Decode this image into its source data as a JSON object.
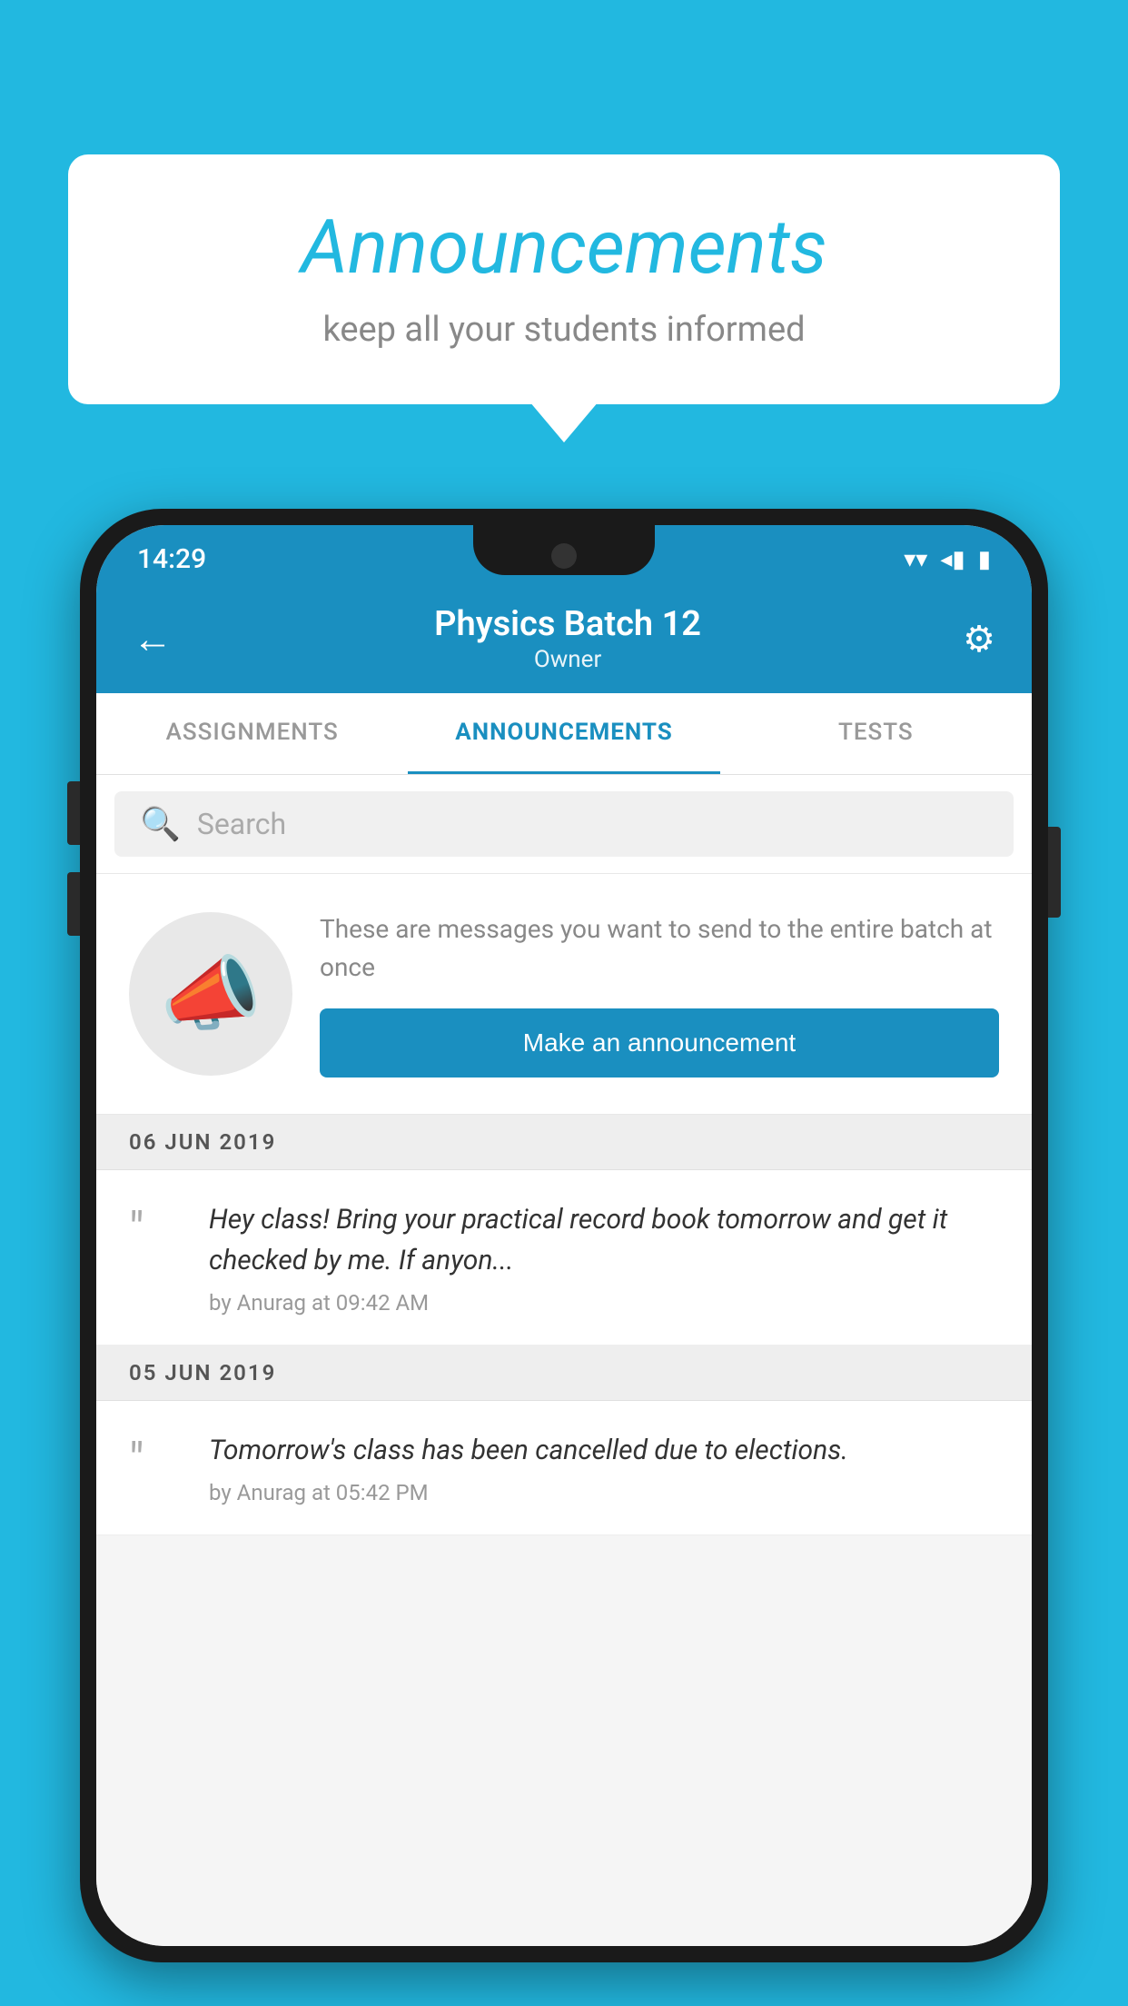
{
  "background_color": "#22b8e0",
  "speech_bubble": {
    "title": "Announcements",
    "subtitle": "keep all your students informed"
  },
  "phone": {
    "status_bar": {
      "time": "14:29",
      "wifi": "▼",
      "signal": "◂",
      "battery": "▮"
    },
    "app_bar": {
      "back_label": "←",
      "title": "Physics Batch 12",
      "subtitle": "Owner",
      "settings_label": "⚙"
    },
    "tabs": [
      {
        "label": "ASSIGNMENTS",
        "active": false
      },
      {
        "label": "ANNOUNCEMENTS",
        "active": true
      },
      {
        "label": "TESTS",
        "active": false
      }
    ],
    "search": {
      "placeholder": "Search"
    },
    "intro_card": {
      "description": "These are messages you want to send to the entire batch at once",
      "button_label": "Make an announcement"
    },
    "announcements": [
      {
        "date": "06  JUN  2019",
        "items": [
          {
            "text": "Hey class! Bring your practical record book tomorrow and get it checked by me. If anyon...",
            "meta": "by Anurag at 09:42 AM"
          }
        ]
      },
      {
        "date": "05  JUN  2019",
        "items": [
          {
            "text": "Tomorrow's class has been cancelled due to elections.",
            "meta": "by Anurag at 05:42 PM"
          }
        ]
      }
    ]
  }
}
